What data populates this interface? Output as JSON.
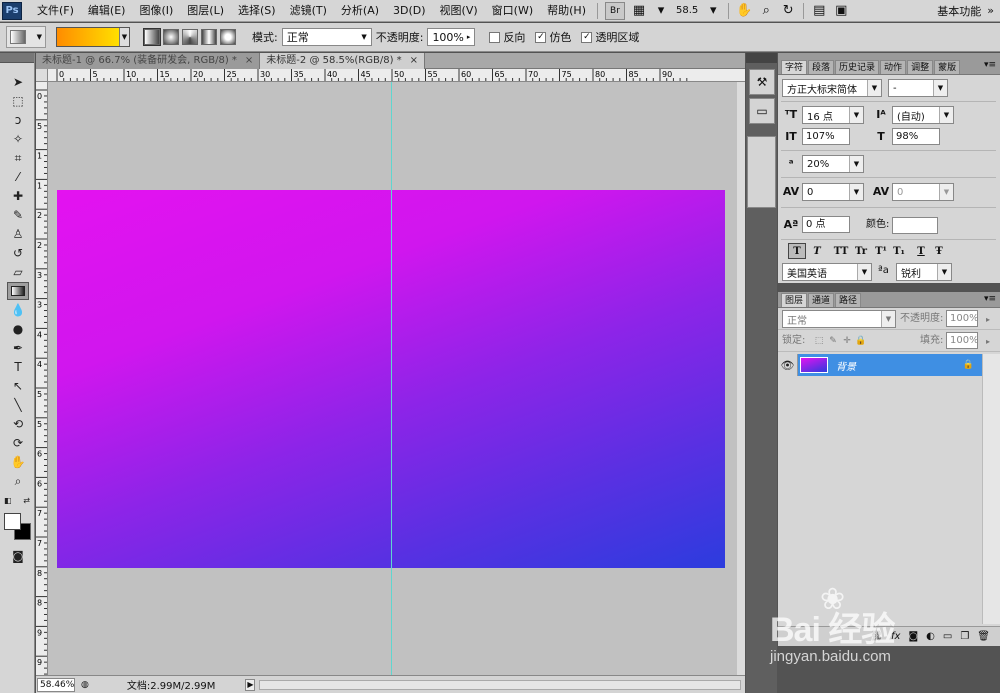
{
  "menubar": {
    "logo": "Ps",
    "items": [
      "文件(F)",
      "编辑(E)",
      "图像(I)",
      "图层(L)",
      "选择(S)",
      "滤镜(T)",
      "分析(A)",
      "3D(D)",
      "视图(V)",
      "窗口(W)",
      "帮助(H)"
    ],
    "bridge_label": "Br",
    "zoom_value": "58.5",
    "workspace_label": "基本功能"
  },
  "options": {
    "mode_label": "模式:",
    "mode_value": "正常",
    "opacity_label": "不透明度:",
    "opacity_value": "100%",
    "reverse_label": "反向",
    "dither_label": "仿色",
    "transparency_label": "透明区域",
    "reverse_checked": false,
    "dither_checked": true,
    "transparency_checked": true,
    "gradient_colors": [
      "#ff8c00",
      "#ffe000"
    ]
  },
  "tabs": [
    {
      "label": "未标题-1 @ 66.7% (装备研发会, RGB/8) *",
      "close": "×"
    },
    {
      "label": "未标题-2 @ 58.5%(RGB/8) *",
      "close": "×"
    }
  ],
  "rulers": {
    "h": [
      "0",
      "5",
      "10",
      "15",
      "20",
      "25",
      "30",
      "35",
      "40",
      "45",
      "50",
      "55",
      "60",
      "65",
      "70",
      "75",
      "80",
      "85",
      "90"
    ],
    "v": [
      "0",
      "5",
      "1",
      "1",
      "2",
      "2",
      "3",
      "3",
      "4",
      "4",
      "5",
      "5",
      "6",
      "6",
      "7",
      "7",
      "8",
      "8",
      "9",
      "9"
    ]
  },
  "canvas": {
    "gradient_start": "#e412f0",
    "gradient_end": "#2c3cde",
    "guide_color": "#5fd6cf"
  },
  "status": {
    "zoom": "58.46%",
    "doc_info": "文档:2.99M/2.99M"
  },
  "character_panel": {
    "tabs": [
      "字符",
      "段落",
      "历史记录",
      "动作",
      "调整",
      "蒙版"
    ],
    "font_family": "方正大标宋简体",
    "font_style": "-",
    "font_size": "16 点",
    "leading": "(自动)",
    "vertical_scale": "107%",
    "horizontal_scale": "98%",
    "tsume": "20%",
    "kerning": "0",
    "tracking": "0",
    "baseline_shift": "0 点",
    "color_label": "颜色:",
    "style_buttons": [
      "T",
      "T",
      "TT",
      "Tr",
      "T¹",
      "T₁",
      "T",
      "Ŧ"
    ],
    "language": "美国英语",
    "aa_label": "ªa",
    "antialias": "锐利"
  },
  "layers_panel": {
    "tabs": [
      "图层",
      "通道",
      "路径"
    ],
    "blend_mode": "正常",
    "opacity_label": "不透明度:",
    "opacity_value": "100%",
    "lock_label": "锁定:",
    "fill_label": "填充:",
    "fill_value": "100%",
    "layer_name": "背景",
    "footer_icons": [
      "link-icon",
      "fx-icon",
      "mask-icon",
      "adjustment-icon",
      "folder-icon",
      "new-layer-icon",
      "trash-icon"
    ]
  },
  "watermark": {
    "brand": "Bai 经验",
    "url": "jingyan.baidu.com"
  }
}
